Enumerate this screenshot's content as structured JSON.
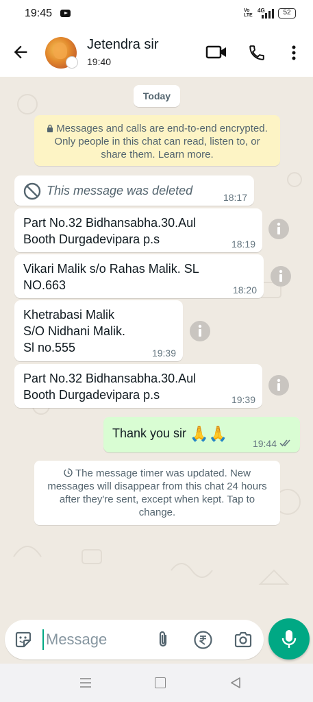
{
  "status_bar": {
    "time": "19:45",
    "network": "4G",
    "volte": "Vo\nLTE",
    "battery": "52"
  },
  "header": {
    "contact_name": "Jetendra sir",
    "last_seen": "19:40"
  },
  "chat": {
    "date_chip": "Today",
    "encryption_notice": "Messages and calls are end-to-end encrypted. Only people in this chat can read, listen to, or share them. Learn more.",
    "messages": [
      {
        "text": "This message was deleted",
        "time": "18:17"
      },
      {
        "text": "Part No.32 Bidhansabha.30.Aul\nBooth Durgadevipara  p.s",
        "time": "18:19"
      },
      {
        "text": "Vikari Malik s/o Rahas Malik. SL\nNO.663",
        "time": "18:20"
      },
      {
        "text": "Khetrabasi Malik\nS/O Nidhani Malik.\nSl no.555",
        "time": "19:39"
      },
      {
        "text": "Part No.32 Bidhansabha.30.Aul\nBooth Durgadevipara  p.s",
        "time": "19:39"
      },
      {
        "text": "Thank you sir",
        "emoji": "🙏🙏",
        "time": "19:44"
      }
    ],
    "timer_notice": "The message timer was updated. New messages will disappear from this chat 24 hours after they're sent, except when kept. Tap to change."
  },
  "composer": {
    "placeholder": "Message"
  },
  "colors": {
    "accent": "#00a884",
    "outgoing_bubble": "#d9fdd3",
    "chat_background": "#efeae2",
    "notice_yellow": "#fdf4c5"
  },
  "icons": [
    "back-arrow-icon",
    "video-call-icon",
    "voice-call-icon",
    "more-options-icon",
    "lock-icon",
    "deleted-icon",
    "info-icon",
    "double-check-icon",
    "timer-icon",
    "sticker-icon",
    "attach-icon",
    "rupee-icon",
    "camera-icon",
    "mic-icon"
  ]
}
